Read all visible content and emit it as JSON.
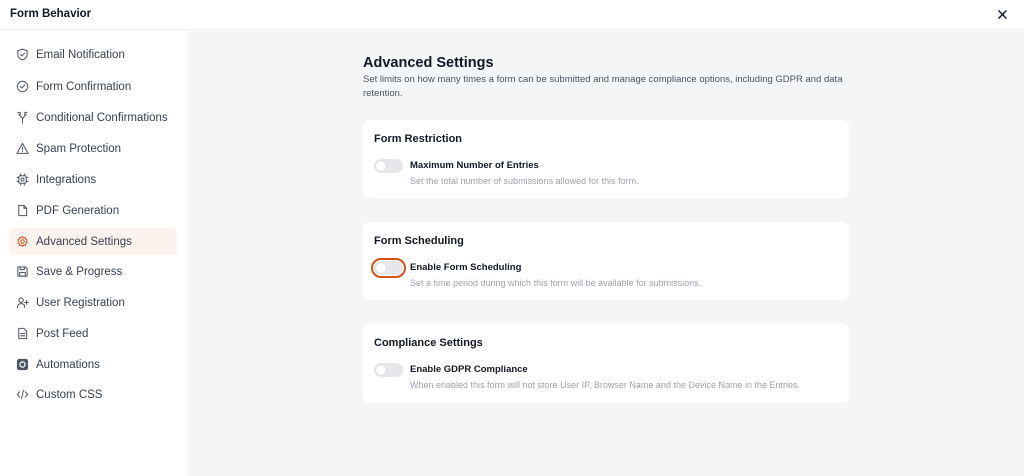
{
  "header": {
    "title": "Form Behavior",
    "close_icon": "close-icon"
  },
  "sidebar": {
    "items": [
      {
        "label": "Email Notification",
        "icon": "shield-check-icon",
        "active": false
      },
      {
        "label": "Form Confirmation",
        "icon": "check-circle-icon",
        "active": false
      },
      {
        "label": "Conditional Confirmations",
        "icon": "split-arrow-icon",
        "active": false
      },
      {
        "label": "Spam Protection",
        "icon": "warning-triangle-icon",
        "active": false
      },
      {
        "label": "Integrations",
        "icon": "chip-icon",
        "active": false
      },
      {
        "label": "PDF Generation",
        "icon": "document-icon",
        "active": false
      },
      {
        "label": "Advanced Settings",
        "icon": "gear-icon",
        "active": true
      },
      {
        "label": "Save & Progress",
        "icon": "floppy-disk-icon",
        "active": false
      },
      {
        "label": "User Registration",
        "icon": "user-plus-icon",
        "active": false
      },
      {
        "label": "Post Feed",
        "icon": "file-text-icon",
        "active": false
      },
      {
        "label": "Automations",
        "icon": "automation-icon",
        "active": false
      },
      {
        "label": "Custom CSS",
        "icon": "code-icon",
        "active": false
      }
    ]
  },
  "main": {
    "title": "Advanced Settings",
    "description": "Set limits on how many times a form can be submitted and manage compliance options, including GDPR and data retention.",
    "cards": [
      {
        "title": "Form Restriction",
        "option_label": "Maximum Number of Entries",
        "option_desc": "Set the total number of submissions allowed for this form.",
        "enabled": false
      },
      {
        "title": "Form Scheduling",
        "option_label": "Enable Form Scheduling",
        "option_desc": "Set a time period during which this form will be available for submissions.",
        "enabled": false
      },
      {
        "title": "Compliance Settings",
        "option_label": "Enable GDPR Compliance",
        "option_desc": "When enabled this form will not store User IP, Browser Name and the Device Name in the Entries.",
        "enabled": false
      }
    ]
  },
  "colors": {
    "accent": "#D4521C",
    "active_bg": "#FDF3EE",
    "content_bg": "#F4F5F7"
  }
}
